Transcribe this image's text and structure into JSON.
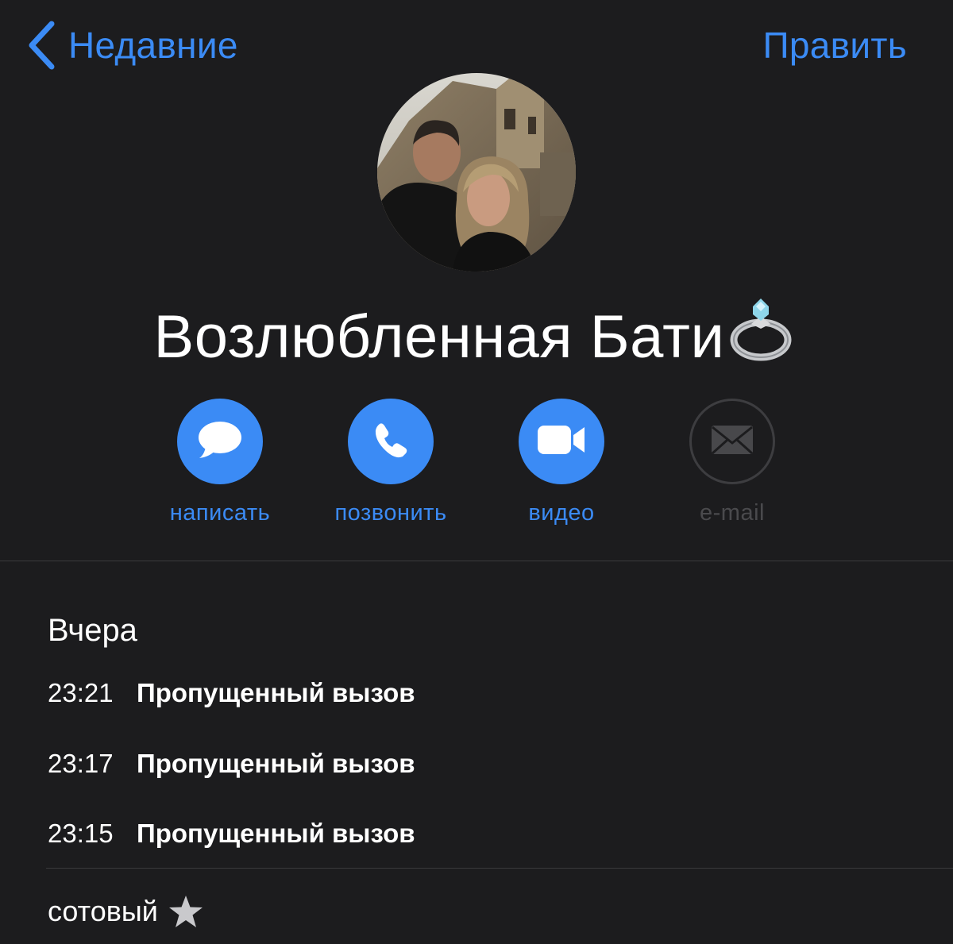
{
  "nav": {
    "back_label": "Недавние",
    "edit_label": "Править"
  },
  "contact": {
    "name": "Возлюбленная Бати",
    "name_emoji": "ring-icon"
  },
  "actions": [
    {
      "label": "написать",
      "icon": "message-bubble-icon",
      "enabled": true
    },
    {
      "label": "позвонить",
      "icon": "phone-icon",
      "enabled": true
    },
    {
      "label": "видео",
      "icon": "video-camera-icon",
      "enabled": true
    },
    {
      "label": "e-mail",
      "icon": "envelope-icon",
      "enabled": false
    }
  ],
  "history": {
    "date": "Вчера",
    "calls": [
      {
        "time": "23:21",
        "status": "Пропущенный вызов"
      },
      {
        "time": "23:17",
        "status": "Пропущенный вызов"
      },
      {
        "time": "23:15",
        "status": "Пропущенный вызов"
      }
    ]
  },
  "phone": {
    "label": "сотовый",
    "favorite_icon": "star-icon"
  },
  "colors": {
    "background": "#1c1c1e",
    "accent": "#3b8bf5",
    "disabled": "#4a4a4d",
    "separator": "#3a3a3c"
  }
}
